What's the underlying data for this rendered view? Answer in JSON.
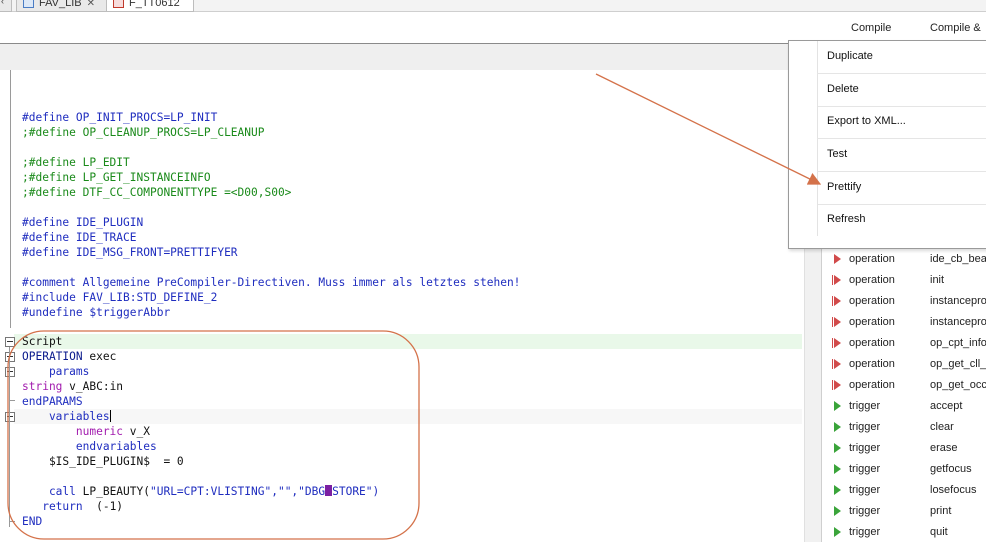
{
  "tabs": [
    {
      "label": "FAV_LIB",
      "active": false
    },
    {
      "label": "F_TT0612",
      "active": true
    }
  ],
  "toolbar": {
    "compile_label": "Compile",
    "compile_and_label": "Compile &"
  },
  "editor": {
    "lines": [
      {
        "t": "#define OP_INIT_PROCS=LP_INIT",
        "c": "blue"
      },
      {
        "t": ";#define OP_CLEANUP_PROCS=LP_CLEANUP",
        "c": "green"
      },
      {
        "t": "",
        "c": "dark"
      },
      {
        "t": ";#define LP_EDIT",
        "c": "green"
      },
      {
        "t": ";#define LP_GET_INSTANCEINFO",
        "c": "green"
      },
      {
        "t": ";#define DTF_CC_COMPONENTTYPE =<D00,S00>",
        "c": "green"
      },
      {
        "t": "",
        "c": "dark"
      },
      {
        "t": "#define IDE_PLUGIN",
        "c": "blue"
      },
      {
        "t": "#define IDE_TRACE",
        "c": "blue"
      },
      {
        "t": "#define IDE_MSG_FRONT=PRETTIFYER",
        "c": "blue"
      },
      {
        "t": "",
        "c": "dark"
      },
      {
        "t": "#comment Allgemeine PreCompiler-Directiven. Muss immer als letztes stehen!",
        "c": "blue"
      },
      {
        "t": "#include FAV_LIB:STD_DEFINE_2",
        "c": "blue"
      },
      {
        "t": "#undefine $triggerAbbr",
        "c": "blue"
      }
    ],
    "script_lines": {
      "script": "Script",
      "operation_kw": "OPERATION",
      "operation_name": " exec",
      "params": "    params",
      "string_kw": "string",
      "string_rest": " v_ABC:in",
      "endparams": "endPARAMS",
      "variables": "    variables",
      "numeric_kw": "        numeric",
      "numeric_rest": " v_X",
      "endvariables": "        endvariables",
      "assign": "    $IS_IDE_PLUGIN$  = 0",
      "call_kw": "    call",
      "call_fn": " LP_BEAUTY(",
      "call_args_a": "\"URL=CPT:VLISTING\",\"\",\"DBG",
      "call_args_b": "STORE\")",
      "return_kw": "   return",
      "return_val": "  (-1)",
      "end": "END"
    }
  },
  "context_menu": {
    "items": [
      "Duplicate",
      "Delete",
      "Export to XML...",
      "Test",
      "Prettify",
      "Refresh"
    ]
  },
  "outline": {
    "rows": [
      {
        "kind": "operation",
        "name": "ide_cb_beau",
        "icon": "red"
      },
      {
        "kind": "operation",
        "name": "init",
        "icon": "red-line"
      },
      {
        "kind": "operation",
        "name": "instancepro",
        "icon": "red-line"
      },
      {
        "kind": "operation",
        "name": "instancepro",
        "icon": "red-line"
      },
      {
        "kind": "operation",
        "name": "op_cpt_info",
        "icon": "red-line"
      },
      {
        "kind": "operation",
        "name": "op_get_cll_h",
        "icon": "red-line"
      },
      {
        "kind": "operation",
        "name": "op_get_occ_",
        "icon": "red-line"
      },
      {
        "kind": "trigger",
        "name": "accept",
        "icon": "green"
      },
      {
        "kind": "trigger",
        "name": "clear",
        "icon": "green"
      },
      {
        "kind": "trigger",
        "name": "erase",
        "icon": "green"
      },
      {
        "kind": "trigger",
        "name": "getfocus",
        "icon": "green"
      },
      {
        "kind": "trigger",
        "name": "losefocus",
        "icon": "green"
      },
      {
        "kind": "trigger",
        "name": "print",
        "icon": "green"
      },
      {
        "kind": "trigger",
        "name": "quit",
        "icon": "green"
      }
    ]
  },
  "colors": {
    "annotation": "#d4724a",
    "keyword": "#1f2dbf",
    "comment": "#1a8a1a",
    "type": "#a21cae"
  }
}
